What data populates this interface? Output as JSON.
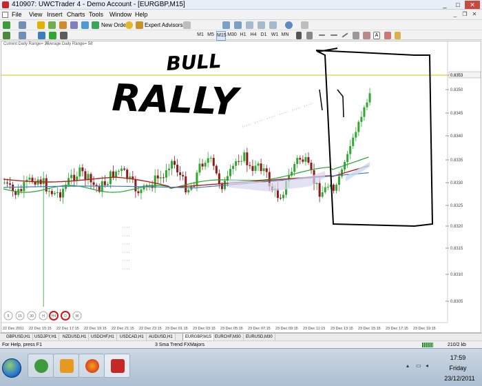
{
  "window": {
    "title": "410907: UWCTrader 4 - Demo Account - [EURGBP,M15]"
  },
  "menu": [
    "File",
    "View",
    "Insert",
    "Charts",
    "Tools",
    "Window",
    "Help"
  ],
  "toolbar": {
    "new_order": "New Order",
    "expert_advisors": "Expert Advisors",
    "timeframes": [
      "M1",
      "M5",
      "M15",
      "M30",
      "H1",
      "H4",
      "D1",
      "W1",
      "MN"
    ],
    "active_timeframe": "M15"
  },
  "chart": {
    "indicator_labels": [
      "Current Daily Range= 37",
      "Average Daily Range= 58"
    ],
    "price_levels": [
      "0.8355",
      "0.8350",
      "0.8345",
      "0.8340",
      "0.8335",
      "0.8330",
      "0.8325",
      "0.8320",
      "0.8315",
      "0.8310",
      "0.8305"
    ],
    "current_price": "0.8353",
    "time_labels": [
      "22 Dec 2011",
      "22 Dec 15:15",
      "22 Dec 17:15",
      "22 Dec 19:15",
      "22 Dec 21:15",
      "22 Dec 23:15",
      "23 Dec 01:15",
      "23 Dec 03:15",
      "23 Dec 05:15",
      "23 Dec 07:15",
      "23 Dec 09:15",
      "23 Dec 11:15",
      "23 Dec 13:15",
      "23 Dec 15:15",
      "23 Dec 17:15",
      "23 Dec 19:15"
    ],
    "circle_buttons": [
      "5",
      "15",
      "30",
      "H",
      "H4",
      "D",
      "W"
    ],
    "handwriting": [
      "BULL",
      "RALLY"
    ],
    "colors": {
      "bull": "#2ea82e",
      "bear": "#8b1a1a",
      "ma_green": "#22a52a",
      "ma_red": "#b52020",
      "ma_blue": "#3b7dbf",
      "level": "#e6c200"
    }
  },
  "symbol_tabs": [
    "GBPUSD,H1",
    "USDJPY,H1",
    "NZDUSD,H1",
    "USDCHF,H1",
    "USDCAD,H1",
    "AUDUSD,H1",
    "EURGBP,M15",
    "EURCHF,M30",
    "EURUSD,M30"
  ],
  "active_tab": "EURGBP,M15",
  "status": {
    "help": "For Help, press F1",
    "profile": "3 Sma Trend FXMajors",
    "traffic": "210/2 kb"
  },
  "taskbar": {
    "time": "17:59",
    "day": "Friday",
    "date": "23/12/2011",
    "apps": [
      "utorrent-icon",
      "outlook-icon",
      "firefox-icon",
      "trader-icon"
    ]
  }
}
